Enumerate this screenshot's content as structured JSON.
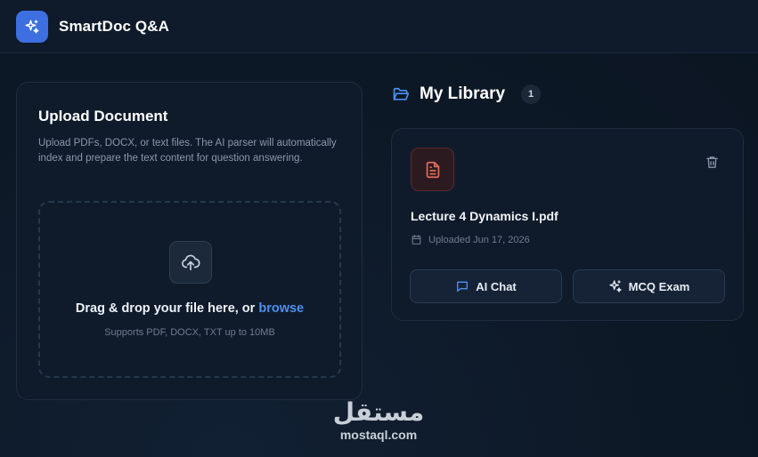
{
  "app": {
    "title": "SmartDoc Q&A",
    "accent_color": "#3d6fe0",
    "logo_icon": "sparkles-icon"
  },
  "upload": {
    "title": "Upload Document",
    "description": "Upload PDFs, DOCX, or text files. The AI parser will automatically index and prepare the text content for question answering.",
    "dropzone": {
      "icon": "cloud-upload-icon",
      "text": "Drag & drop your file here, or ",
      "browse_label": "browse",
      "hint": "Supports PDF, DOCX, TXT up to 10MB"
    }
  },
  "library": {
    "title": "My Library",
    "count": "1",
    "icon": "folder-open-icon",
    "documents": [
      {
        "name": "Lecture 4 Dynamics I.pdf",
        "uploaded": "Uploaded Jun 17, 2026",
        "file_icon": "file-text-icon",
        "file_icon_color": "#e06a5a",
        "actions": {
          "chat_label": "AI Chat",
          "mcq_label": "MCQ Exam"
        }
      }
    ]
  },
  "watermark": {
    "arabic": "مستقل",
    "latin": "mostaql.com"
  }
}
